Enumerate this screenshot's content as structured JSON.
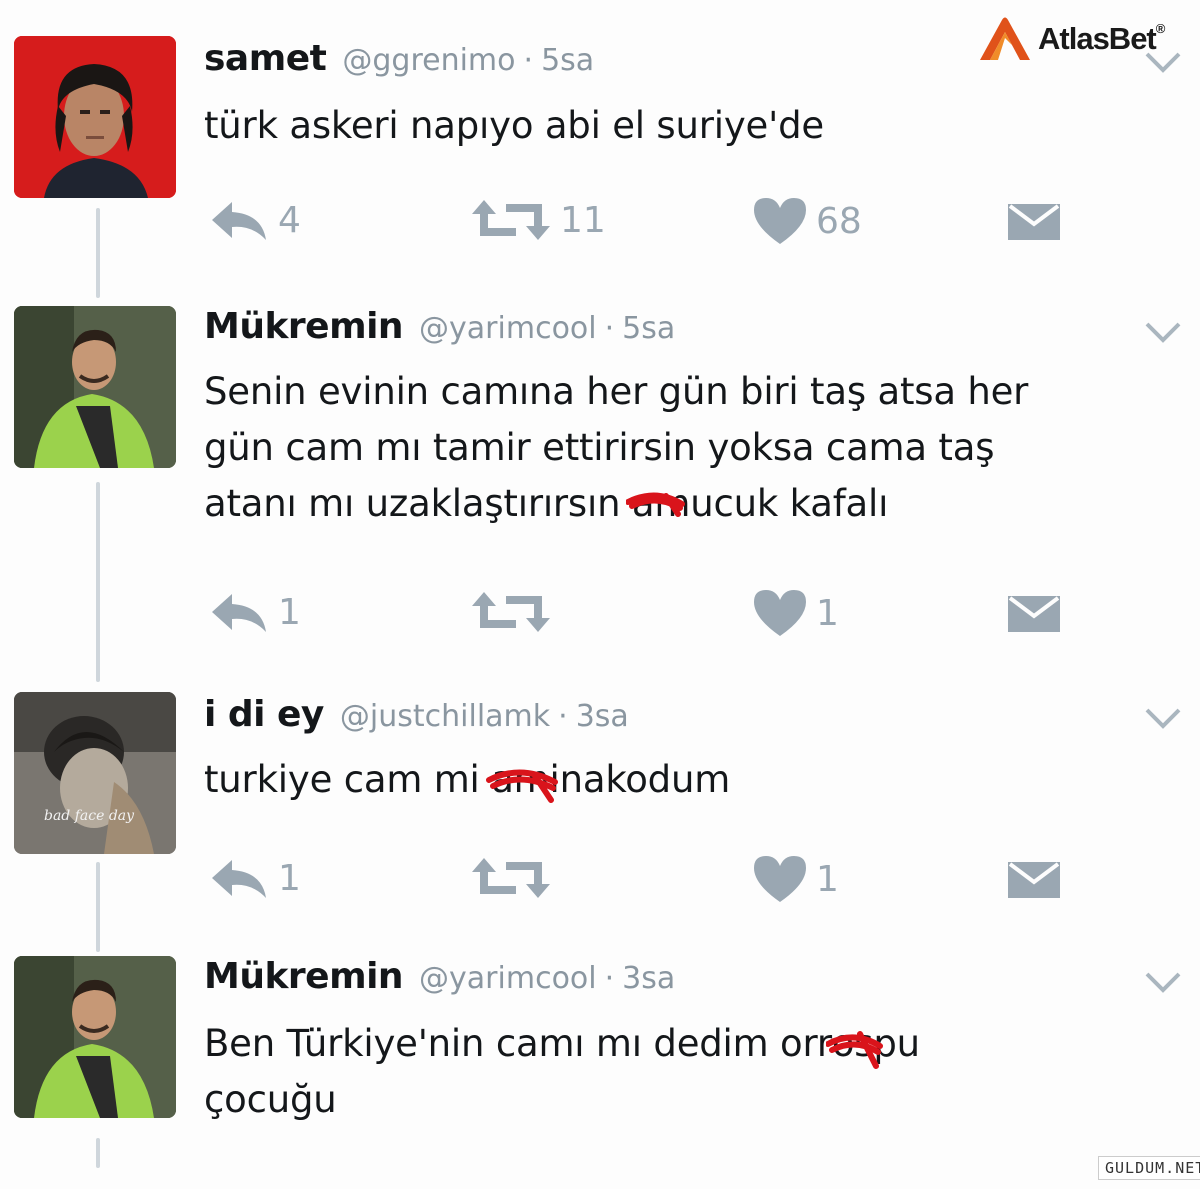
{
  "watermark": {
    "brand": "AtlasBet",
    "registered": "®"
  },
  "footer_watermark": "GULDUM.NET",
  "tweets": [
    {
      "name": "samet",
      "handle": "@ggrenimo",
      "sep": "·",
      "time": "5sa",
      "text": "türk askeri napıyo abi el suriye'de",
      "replies": "4",
      "retweets": "11",
      "likes": "68"
    },
    {
      "name": "Mükremin",
      "handle": "@yarimcool",
      "sep": "·",
      "time": "5sa",
      "text_line1": "Senin evinin camına her gün biri taş atsa her",
      "text_line2": "gün cam mı tamir ettirirsin yoksa cama taş",
      "text_line3_pre": "atanı mı uzaklaştırırsın ",
      "text_line3_redacted": "a",
      "text_line3_post": "mucuk kafalı",
      "replies": "1",
      "retweets": "",
      "likes": "1"
    },
    {
      "name": "i di ey",
      "handle": "@justchillamk",
      "sep": "·",
      "time": "3sa",
      "avatar_caption": "bad face day",
      "text_pre": "turkiye cam mi ",
      "text_redacted": "am",
      "text_post": "inakodum",
      "replies": "1",
      "retweets": "",
      "likes": "1"
    },
    {
      "name": "Mükremin",
      "handle": "@yarimcool",
      "sep": "·",
      "time": "3sa",
      "text_line1_pre": "Ben Türkiye'nin camı mı dedim orr",
      "text_line1_redacted": "o",
      "text_line1_post": "spu",
      "text_line2": "çocuğu",
      "replies": "",
      "retweets": "",
      "likes": ""
    }
  ],
  "colors": {
    "accent_red": "#d9141b",
    "icon_gray": "#9aa7b2",
    "handle_gray": "#8a96a0"
  },
  "icons": [
    "reply-icon",
    "retweet-icon",
    "heart-icon",
    "dm-icon",
    "chevron-down-icon"
  ]
}
